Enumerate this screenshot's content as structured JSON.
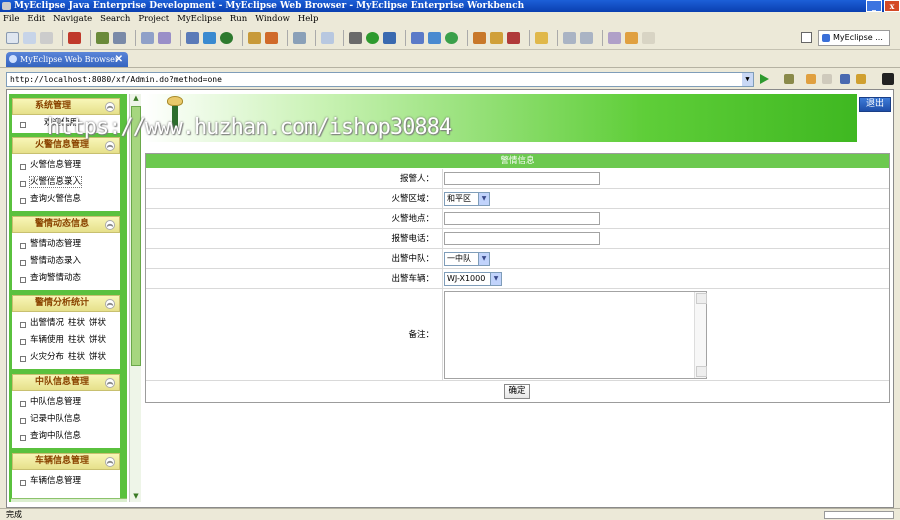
{
  "window": {
    "title": "MyEclipse Java Enterprise Development - MyEclipse Web Browser - MyEclipse Enterprise Workbench"
  },
  "menu": [
    "File",
    "Edit",
    "Navigate",
    "Search",
    "Project",
    "MyEclipse",
    "Run",
    "Window",
    "Help"
  ],
  "toolbar": {
    "perspective_label": "MyEclipse ..."
  },
  "editor_tab": {
    "label": "MyEclipse Web Browser",
    "close": "✕"
  },
  "address": {
    "url": "http://localhost:8080/xf/Admin.do?method=one"
  },
  "page": {
    "watermark": "https://www.huzhan.com/ishop30884",
    "logout_label": "退出",
    "sidebar": {
      "groups": [
        {
          "title": "系统管理",
          "items": [
            {
              "label": "欢迎使用"
            }
          ]
        },
        {
          "title": "火警信息管理",
          "items": [
            {
              "label": "火警信息管理"
            },
            {
              "label": "火警信息录入"
            },
            {
              "label": "查询火警信息"
            }
          ]
        },
        {
          "title": "警情动态信息",
          "items": [
            {
              "label": "警情动态管理"
            },
            {
              "label": "警情动态录入"
            },
            {
              "label": "查询警情动态"
            }
          ]
        },
        {
          "title": "警情分析统计",
          "items": [
            {
              "label": "出警情况",
              "extra": [
                "柱状",
                "饼状"
              ]
            },
            {
              "label": "车辆使用",
              "extra": [
                "柱状",
                "饼状"
              ]
            },
            {
              "label": "火灾分布",
              "extra": [
                "柱状",
                "饼状"
              ]
            }
          ]
        },
        {
          "title": "中队信息管理",
          "items": [
            {
              "label": "中队信息管理"
            },
            {
              "label": "记录中队信息"
            },
            {
              "label": "查询中队信息"
            }
          ]
        },
        {
          "title": "车辆信息管理",
          "items": [
            {
              "label": "车辆信息管理"
            }
          ]
        }
      ]
    },
    "form": {
      "title": "警情信息",
      "fields": {
        "reporter": {
          "label": "报警人：",
          "value": ""
        },
        "area": {
          "label": "火警区域：",
          "value": "和平区"
        },
        "location": {
          "label": "火警地点：",
          "value": ""
        },
        "phone": {
          "label": "报警电话：",
          "value": ""
        },
        "squad": {
          "label": "出警中队：",
          "value": "一中队"
        },
        "vehicle": {
          "label": "出警车辆：",
          "value": "WJ-X1000"
        },
        "remarks": {
          "label": "备注：",
          "value": ""
        }
      },
      "submit_label": "确定"
    }
  },
  "status": {
    "text": "完成"
  },
  "colors": {
    "sidebar_green": "#5ac13e",
    "panel_title": "#6cc94f",
    "header_text": "#8a4400",
    "title_bar": "#0a3fb0"
  }
}
